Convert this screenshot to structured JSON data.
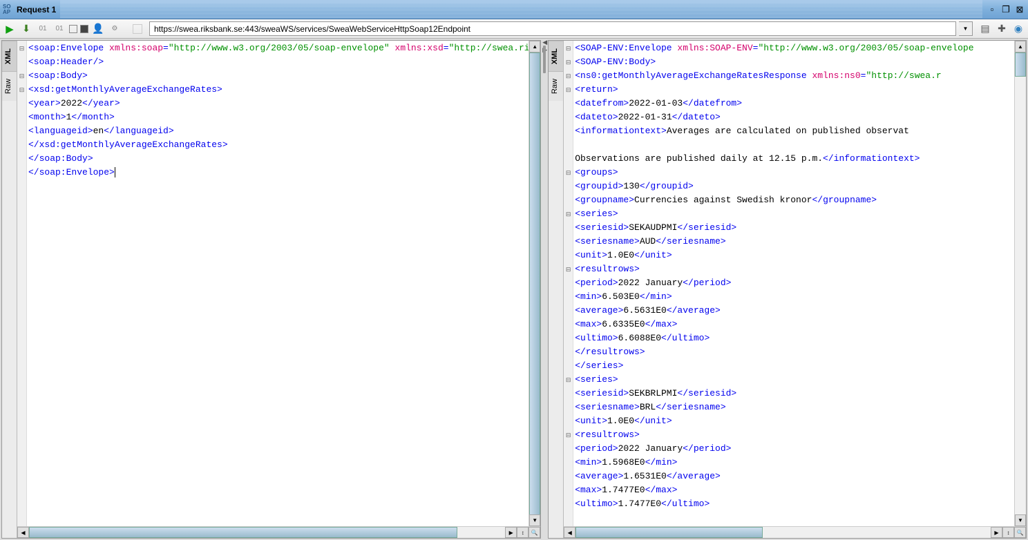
{
  "titlebar": {
    "icon_label": "SO\nAP",
    "title": "Request 1"
  },
  "toolbar": {
    "url": "https://swea.riksbank.se:443/sweaWS/services/SweaWebServiceHttpSoap12Endpoint"
  },
  "side_tabs": {
    "xml": "XML",
    "raw": "Raw"
  },
  "request_xml": {
    "lines": [
      {
        "indent": 0,
        "parts": [
          {
            "c": "t-tag",
            "t": "<soap:Envelope "
          },
          {
            "c": "t-attr",
            "t": "xmlns:soap"
          },
          {
            "c": "t-tag",
            "t": "="
          },
          {
            "c": "t-str",
            "t": "\"http://www.w3.org/2003/05/soap-envelope\""
          },
          {
            "c": "t-tag",
            "t": " "
          },
          {
            "c": "t-attr",
            "t": "xmlns:xsd"
          },
          {
            "c": "t-tag",
            "t": "="
          },
          {
            "c": "t-str",
            "t": "\"http://swea.riks"
          }
        ]
      },
      {
        "indent": 1,
        "parts": [
          {
            "c": "t-tag",
            "t": "<soap:Header/>"
          }
        ]
      },
      {
        "indent": 1,
        "parts": [
          {
            "c": "t-tag",
            "t": "<soap:Body>"
          }
        ]
      },
      {
        "indent": 2,
        "parts": [
          {
            "c": "t-tag",
            "t": "<xsd:getMonthlyAverageExchangeRates>"
          }
        ]
      },
      {
        "indent": 3,
        "parts": [
          {
            "c": "t-tag",
            "t": "<year>"
          },
          {
            "c": "t-txt",
            "t": "2022"
          },
          {
            "c": "t-tag",
            "t": "</year>"
          }
        ]
      },
      {
        "indent": 3,
        "parts": [
          {
            "c": "t-tag",
            "t": "<month>"
          },
          {
            "c": "t-txt",
            "t": "1"
          },
          {
            "c": "t-tag",
            "t": "</month>"
          }
        ]
      },
      {
        "indent": 3,
        "parts": [
          {
            "c": "t-tag",
            "t": "<languageid>"
          },
          {
            "c": "t-txt",
            "t": "en"
          },
          {
            "c": "t-tag",
            "t": "</languageid>"
          }
        ]
      },
      {
        "indent": 2,
        "parts": [
          {
            "c": "t-tag",
            "t": "</xsd:getMonthlyAverageExchangeRates>"
          }
        ]
      },
      {
        "indent": 1,
        "parts": [
          {
            "c": "t-tag",
            "t": "</soap:Body>"
          }
        ]
      },
      {
        "indent": 0,
        "parts": [
          {
            "c": "t-tag",
            "t": "</soap:Envelope>"
          }
        ],
        "cursor": true
      }
    ],
    "folds": [
      "⊟",
      "",
      "⊟",
      "⊟",
      "",
      "",
      "",
      "",
      "",
      ""
    ]
  },
  "response_xml": {
    "lines": [
      {
        "indent": 0,
        "parts": [
          {
            "c": "t-tag",
            "t": "<SOAP-ENV:Envelope "
          },
          {
            "c": "t-attr",
            "t": "xmlns:SOAP-ENV"
          },
          {
            "c": "t-tag",
            "t": "="
          },
          {
            "c": "t-str",
            "t": "\"http://www.w3.org/2003/05/soap-envelope"
          }
        ]
      },
      {
        "indent": 1,
        "parts": [
          {
            "c": "t-tag",
            "t": "<SOAP-ENV:Body>"
          }
        ]
      },
      {
        "indent": 2,
        "parts": [
          {
            "c": "t-tag",
            "t": "<ns0:getMonthlyAverageExchangeRatesResponse "
          },
          {
            "c": "t-attr",
            "t": "xmlns:ns0"
          },
          {
            "c": "t-tag",
            "t": "="
          },
          {
            "c": "t-str",
            "t": "\"http://swea.r"
          }
        ]
      },
      {
        "indent": 3,
        "parts": [
          {
            "c": "t-tag",
            "t": "<return>"
          }
        ]
      },
      {
        "indent": 4,
        "parts": [
          {
            "c": "t-tag",
            "t": "<datefrom>"
          },
          {
            "c": "t-txt",
            "t": "2022-01-03"
          },
          {
            "c": "t-tag",
            "t": "</datefrom>"
          }
        ]
      },
      {
        "indent": 4,
        "parts": [
          {
            "c": "t-tag",
            "t": "<dateto>"
          },
          {
            "c": "t-txt",
            "t": "2022-01-31"
          },
          {
            "c": "t-tag",
            "t": "</dateto>"
          }
        ]
      },
      {
        "indent": 4,
        "parts": [
          {
            "c": "t-tag",
            "t": "<informationtext>"
          },
          {
            "c": "t-txt",
            "t": "Averages are calculated on published observat"
          }
        ]
      },
      {
        "indent": 0,
        "parts": [
          {
            "c": "t-txt",
            "t": ""
          }
        ]
      },
      {
        "indent": 0,
        "parts": [
          {
            "c": "t-txt",
            "t": "Observations are published daily at 12.15 p.m."
          },
          {
            "c": "t-tag",
            "t": "</informationtext>"
          }
        ]
      },
      {
        "indent": 4,
        "parts": [
          {
            "c": "t-tag",
            "t": "<groups>"
          }
        ]
      },
      {
        "indent": 5,
        "parts": [
          {
            "c": "t-tag",
            "t": "<groupid>"
          },
          {
            "c": "t-txt",
            "t": "130"
          },
          {
            "c": "t-tag",
            "t": "</groupid>"
          }
        ]
      },
      {
        "indent": 5,
        "parts": [
          {
            "c": "t-tag",
            "t": "<groupname>"
          },
          {
            "c": "t-txt",
            "t": "Currencies against Swedish kronor"
          },
          {
            "c": "t-tag",
            "t": "</groupname>"
          }
        ]
      },
      {
        "indent": 5,
        "parts": [
          {
            "c": "t-tag",
            "t": "<series>"
          }
        ]
      },
      {
        "indent": 6,
        "parts": [
          {
            "c": "t-tag",
            "t": "<seriesid>"
          },
          {
            "c": "t-txt",
            "t": "SEKAUDPMI"
          },
          {
            "c": "t-tag",
            "t": "</seriesid>"
          }
        ]
      },
      {
        "indent": 6,
        "parts": [
          {
            "c": "t-tag",
            "t": "<seriesname>"
          },
          {
            "c": "t-txt",
            "t": "AUD"
          },
          {
            "c": "t-tag",
            "t": "</seriesname>"
          }
        ]
      },
      {
        "indent": 6,
        "parts": [
          {
            "c": "t-tag",
            "t": "<unit>"
          },
          {
            "c": "t-txt",
            "t": "1.0E0"
          },
          {
            "c": "t-tag",
            "t": "</unit>"
          }
        ]
      },
      {
        "indent": 6,
        "parts": [
          {
            "c": "t-tag",
            "t": "<resultrows>"
          }
        ]
      },
      {
        "indent": 7,
        "parts": [
          {
            "c": "t-tag",
            "t": "<period>"
          },
          {
            "c": "t-txt",
            "t": "2022 January"
          },
          {
            "c": "t-tag",
            "t": "</period>"
          }
        ]
      },
      {
        "indent": 7,
        "parts": [
          {
            "c": "t-tag",
            "t": "<min>"
          },
          {
            "c": "t-txt",
            "t": "6.503E0"
          },
          {
            "c": "t-tag",
            "t": "</min>"
          }
        ]
      },
      {
        "indent": 7,
        "parts": [
          {
            "c": "t-tag",
            "t": "<average>"
          },
          {
            "c": "t-txt",
            "t": "6.5631E0"
          },
          {
            "c": "t-tag",
            "t": "</average>"
          }
        ]
      },
      {
        "indent": 7,
        "parts": [
          {
            "c": "t-tag",
            "t": "<max>"
          },
          {
            "c": "t-txt",
            "t": "6.6335E0"
          },
          {
            "c": "t-tag",
            "t": "</max>"
          }
        ]
      },
      {
        "indent": 7,
        "parts": [
          {
            "c": "t-tag",
            "t": "<ultimo>"
          },
          {
            "c": "t-txt",
            "t": "6.6088E0"
          },
          {
            "c": "t-tag",
            "t": "</ultimo>"
          }
        ]
      },
      {
        "indent": 6,
        "parts": [
          {
            "c": "t-tag",
            "t": "</resultrows>"
          }
        ]
      },
      {
        "indent": 5,
        "parts": [
          {
            "c": "t-tag",
            "t": "</series>"
          }
        ]
      },
      {
        "indent": 5,
        "parts": [
          {
            "c": "t-tag",
            "t": "<series>"
          }
        ]
      },
      {
        "indent": 6,
        "parts": [
          {
            "c": "t-tag",
            "t": "<seriesid>"
          },
          {
            "c": "t-txt",
            "t": "SEKBRLPMI"
          },
          {
            "c": "t-tag",
            "t": "</seriesid>"
          }
        ]
      },
      {
        "indent": 6,
        "parts": [
          {
            "c": "t-tag",
            "t": "<seriesname>"
          },
          {
            "c": "t-txt",
            "t": "BRL"
          },
          {
            "c": "t-tag",
            "t": "</seriesname>"
          }
        ]
      },
      {
        "indent": 6,
        "parts": [
          {
            "c": "t-tag",
            "t": "<unit>"
          },
          {
            "c": "t-txt",
            "t": "1.0E0"
          },
          {
            "c": "t-tag",
            "t": "</unit>"
          }
        ]
      },
      {
        "indent": 6,
        "parts": [
          {
            "c": "t-tag",
            "t": "<resultrows>"
          }
        ]
      },
      {
        "indent": 7,
        "parts": [
          {
            "c": "t-tag",
            "t": "<period>"
          },
          {
            "c": "t-txt",
            "t": "2022 January"
          },
          {
            "c": "t-tag",
            "t": "</period>"
          }
        ]
      },
      {
        "indent": 7,
        "parts": [
          {
            "c": "t-tag",
            "t": "<min>"
          },
          {
            "c": "t-txt",
            "t": "1.5968E0"
          },
          {
            "c": "t-tag",
            "t": "</min>"
          }
        ]
      },
      {
        "indent": 7,
        "parts": [
          {
            "c": "t-tag",
            "t": "<average>"
          },
          {
            "c": "t-txt",
            "t": "1.6531E0"
          },
          {
            "c": "t-tag",
            "t": "</average>"
          }
        ]
      },
      {
        "indent": 7,
        "parts": [
          {
            "c": "t-tag",
            "t": "<max>"
          },
          {
            "c": "t-txt",
            "t": "1.7477E0"
          },
          {
            "c": "t-tag",
            "t": "</max>"
          }
        ]
      },
      {
        "indent": 7,
        "parts": [
          {
            "c": "t-tag",
            "t": "<ultimo>"
          },
          {
            "c": "t-txt",
            "t": "1.7477E0"
          },
          {
            "c": "t-tag",
            "t": "</ultimo>"
          }
        ]
      }
    ],
    "folds": [
      "⊟",
      "⊟",
      "⊟",
      "⊟",
      "",
      "",
      "",
      "",
      "",
      "⊟",
      "",
      "",
      "⊟",
      "",
      "",
      "",
      "⊟",
      "",
      "",
      "",
      "",
      "",
      "",
      "",
      "⊟",
      "",
      "",
      "",
      "⊟",
      "",
      "",
      "",
      "",
      ""
    ]
  }
}
